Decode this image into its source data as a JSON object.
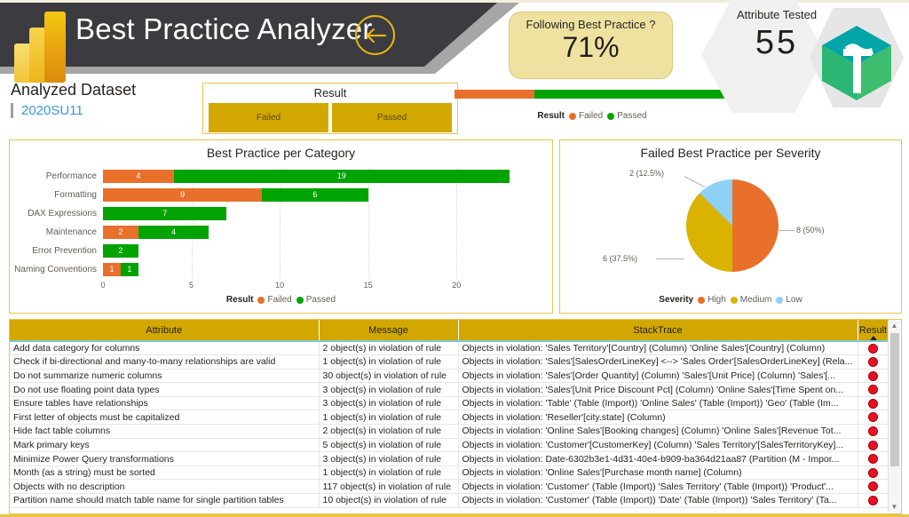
{
  "header": {
    "title": "Best Practice Analyzer",
    "back_icon": "back-arrow-icon",
    "logo_icon": "power-bi-logo"
  },
  "dataset": {
    "label": "Analyzed Dataset",
    "value": "2020SU11"
  },
  "slicer": {
    "title": "Result",
    "options": [
      "Failed",
      "Passed"
    ]
  },
  "kpi": {
    "following_label": "Following Best Practice ?",
    "following_value": "71%",
    "tested_label": "Attribute Tested",
    "tested_value": "55",
    "brand_icon": "tabular-editor-logo"
  },
  "progress": {
    "failed_pct": 29,
    "passed_pct": 71,
    "legend_title": "Result",
    "legend": [
      {
        "label": "Failed",
        "color": "#E8702A"
      },
      {
        "label": "Passed",
        "color": "#00A300"
      }
    ]
  },
  "chart_data": [
    {
      "type": "bar",
      "title": "Best Practice per Category",
      "orientation": "horizontal",
      "stacked": true,
      "categories": [
        "Performance",
        "Formatting",
        "DAX Expressions",
        "Maintenance",
        "Error Prevention",
        "Naming Conventions"
      ],
      "series": [
        {
          "name": "Failed",
          "color": "#E8702A",
          "values": [
            4,
            9,
            0,
            2,
            0,
            1
          ]
        },
        {
          "name": "Passed",
          "color": "#00A300",
          "values": [
            19,
            6,
            7,
            4,
            2,
            1
          ]
        }
      ],
      "xlabel": "",
      "ylabel": "",
      "xlim": [
        0,
        23
      ],
      "xticks": [
        0,
        5,
        10,
        15,
        20
      ],
      "grid": true,
      "legend_title": "Result",
      "legend_position": "bottom"
    },
    {
      "type": "pie",
      "title": "Failed Best Practice per Severity",
      "labels": [
        "High",
        "Medium",
        "Low"
      ],
      "values": [
        8,
        6,
        2
      ],
      "percents": [
        50,
        37.5,
        12.5
      ],
      "colors": [
        "#E8702A",
        "#D9B300",
        "#8FD0F5"
      ],
      "data_labels": [
        "8 (50%)",
        "6 (37.5%)",
        "2 (12.5%)"
      ],
      "legend_title": "Severity",
      "legend_position": "bottom"
    }
  ],
  "table": {
    "columns": [
      "Attribute",
      "Message",
      "StackTrace",
      "Result"
    ],
    "sort_column": "Result",
    "sort_direction": "ascending",
    "stacktrace_prefix": "Objects in violation:",
    "rows": [
      {
        "attribute": "Add data category for columns",
        "message": "2 object(s) in violation of rule",
        "stacktrace": "'Sales Territory'[Country] (Column)   'Online Sales'[Country] (Column)",
        "result": "failed"
      },
      {
        "attribute": "Check if bi-directional and many-to-many relationships are valid",
        "message": "1 object(s) in violation of rule",
        "stacktrace": "'Sales'[SalesOrderLineKey] <--> 'Sales Order'[SalesOrderLineKey] (Rela...",
        "result": "failed"
      },
      {
        "attribute": "Do not summarize numeric columns",
        "message": "30 object(s) in violation of rule",
        "stacktrace": "'Sales'[Order Quantity] (Column)   'Sales'[Unit Price] (Column)   'Sales'[...",
        "result": "failed"
      },
      {
        "attribute": "Do not use floating point data types",
        "message": "3 object(s) in violation of rule",
        "stacktrace": "'Sales'[Unit Price Discount Pct] (Column)   'Online Sales'[Time Spent on...",
        "result": "failed"
      },
      {
        "attribute": "Ensure tables have relationships",
        "message": "3 object(s) in violation of rule",
        "stacktrace": "'Table' (Table (Import))   'Online Sales' (Table (Import))   'Geo' (Table (Im...",
        "result": "failed"
      },
      {
        "attribute": "First letter of objects must be capitalized",
        "message": "1 object(s) in violation of rule",
        "stacktrace": "'Reseller'[city.state] (Column)",
        "result": "failed"
      },
      {
        "attribute": "Hide fact table columns",
        "message": "2 object(s) in violation of rule",
        "stacktrace": "'Online Sales'[Booking changes] (Column)   'Online Sales'[Revenue Tot...",
        "result": "failed"
      },
      {
        "attribute": "Mark primary keys",
        "message": "5 object(s) in violation of rule",
        "stacktrace": "'Customer'[CustomerKey] (Column)   'Sales Territory'[SalesTerritoryKey]...",
        "result": "failed"
      },
      {
        "attribute": "Minimize Power Query transformations",
        "message": "3 object(s) in violation of rule",
        "stacktrace": "Date-6302b3e1-4d31-40e4-b909-ba364d21aa87 (Partition (M - Impor...",
        "result": "failed"
      },
      {
        "attribute": "Month (as a string) must be sorted",
        "message": "1 object(s) in violation of rule",
        "stacktrace": "'Online Sales'[Purchase month name] (Column)",
        "result": "failed"
      },
      {
        "attribute": "Objects with no description",
        "message": "117 object(s) in violation of rule",
        "stacktrace": "'Customer' (Table (Import))   'Sales Territory' (Table (Import))   'Product'...",
        "result": "failed"
      },
      {
        "attribute": "Partition name should match table name for single partition tables",
        "message": "10 object(s) in violation of rule",
        "stacktrace": "'Customer' (Table (Import))   'Date' (Table (Import))   'Sales Territory' (Ta...",
        "result": "failed"
      }
    ]
  }
}
